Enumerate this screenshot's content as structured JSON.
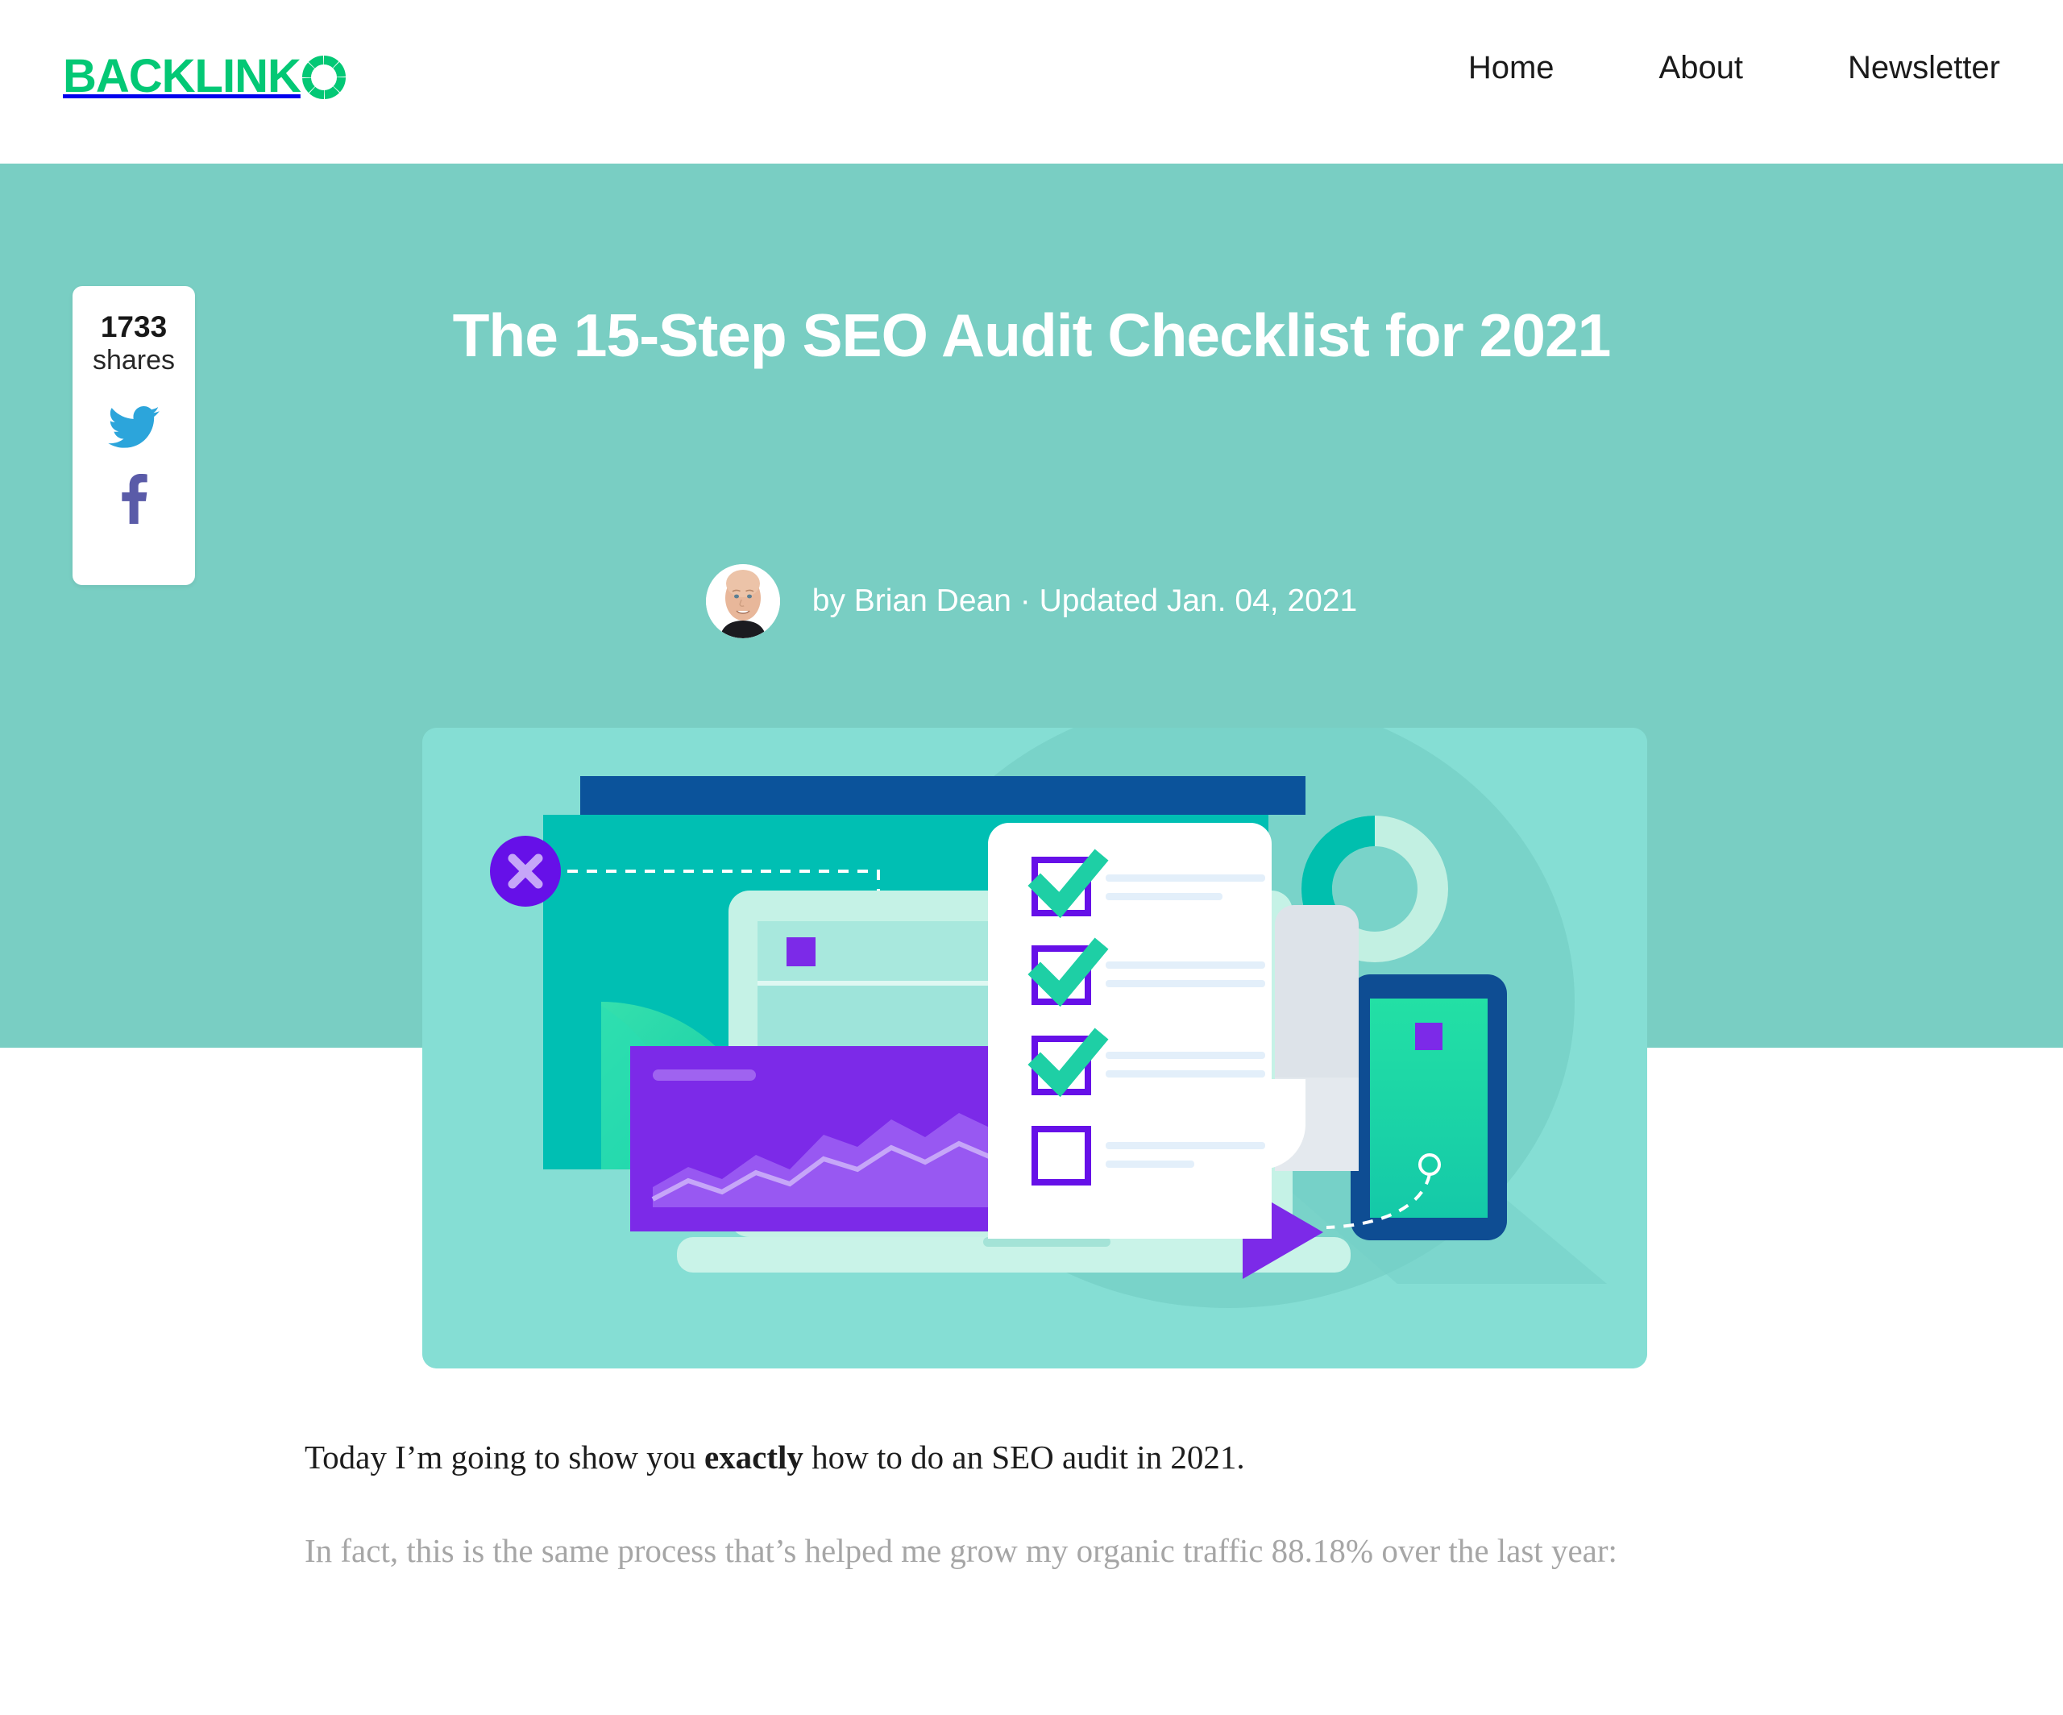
{
  "header": {
    "logo_text": "BACKLINK",
    "logo_icon": "segmented-circle-o",
    "logo_color": "#03c875",
    "nav": [
      {
        "label": "Home"
      },
      {
        "label": "About"
      },
      {
        "label": "Newsletter"
      }
    ]
  },
  "share_widget": {
    "count": "1733",
    "label": "shares",
    "twitter_icon": "twitter-bird-icon",
    "twitter_color": "#2ca5db",
    "facebook_icon": "facebook-f-icon",
    "facebook_color": "#5a5ba8"
  },
  "hero": {
    "background_color": "#79cec3",
    "title": "The 15-Step SEO Audit Checklist for 2021",
    "byline": "by Brian Dean · Updated Jan. 04, 2021",
    "author_name": "Brian Dean",
    "updated_date": "Jan. 04, 2021",
    "avatar_alt": "Brian Dean headshot",
    "illustration": {
      "name": "seo-audit-checklist-illustration",
      "card_color": "#85ded4",
      "colors": {
        "teal_window": "#00bfb3",
        "dark_blue_bar": "#0b539b",
        "purple_accent": "#7c2ae8",
        "deep_purple": "#6610e8",
        "green_check": "#1ecfa5",
        "mint_laptop": "#c5f2e6",
        "phone_frame": "#0e4d93",
        "phone_screen": "#1ed79e",
        "line_blue": "#dcecfa"
      },
      "checkbox_states": [
        "checked",
        "checked",
        "checked",
        "unchecked"
      ]
    }
  },
  "article": {
    "paragraph_1_pre": "Today I’m going to show you ",
    "paragraph_1_bold": "exactly",
    "paragraph_1_post": " how to do an SEO audit in 2021.",
    "paragraph_2": "In fact, this is the same process that’s helped me grow my organic traffic 88.18% over the last year:"
  }
}
